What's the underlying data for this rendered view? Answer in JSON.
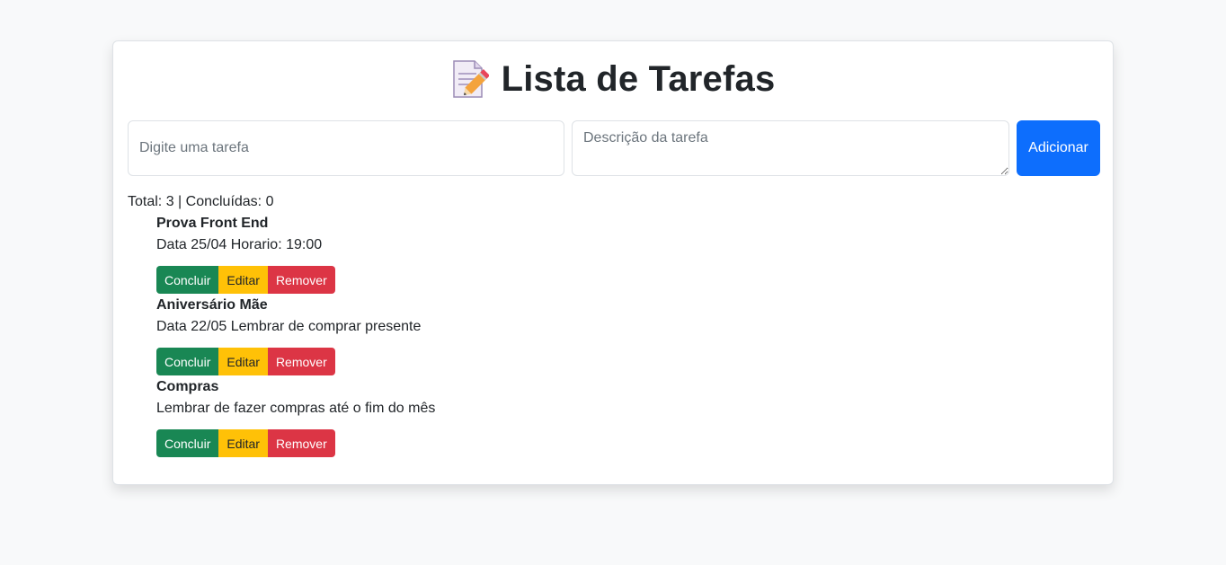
{
  "header": {
    "title": "Lista de Tarefas",
    "icon": "memo-icon"
  },
  "form": {
    "task_placeholder": "Digite uma tarefa",
    "task_value": "",
    "description_placeholder": "Descrição da tarefa",
    "description_value": "",
    "add_label": "Adicionar"
  },
  "summary": {
    "text": "Total: 3 | Concluídas: 0"
  },
  "tasks": [
    {
      "title": "Prova Front End",
      "description": "Data 25/04 Horario: 19:00",
      "complete_label": "Concluir",
      "edit_label": "Editar",
      "remove_label": "Remover"
    },
    {
      "title": "Aniversário Mãe",
      "description": "Data 22/05 Lembrar de comprar presente",
      "complete_label": "Concluir",
      "edit_label": "Editar",
      "remove_label": "Remover"
    },
    {
      "title": "Compras",
      "description": "Lembrar de fazer compras até o fim do mês",
      "complete_label": "Concluir",
      "edit_label": "Editar",
      "remove_label": "Remover"
    }
  ],
  "colors": {
    "primary": "#0d6efd",
    "success": "#198754",
    "warning": "#ffc107",
    "danger": "#dc3545",
    "background": "#f8f9fa"
  }
}
